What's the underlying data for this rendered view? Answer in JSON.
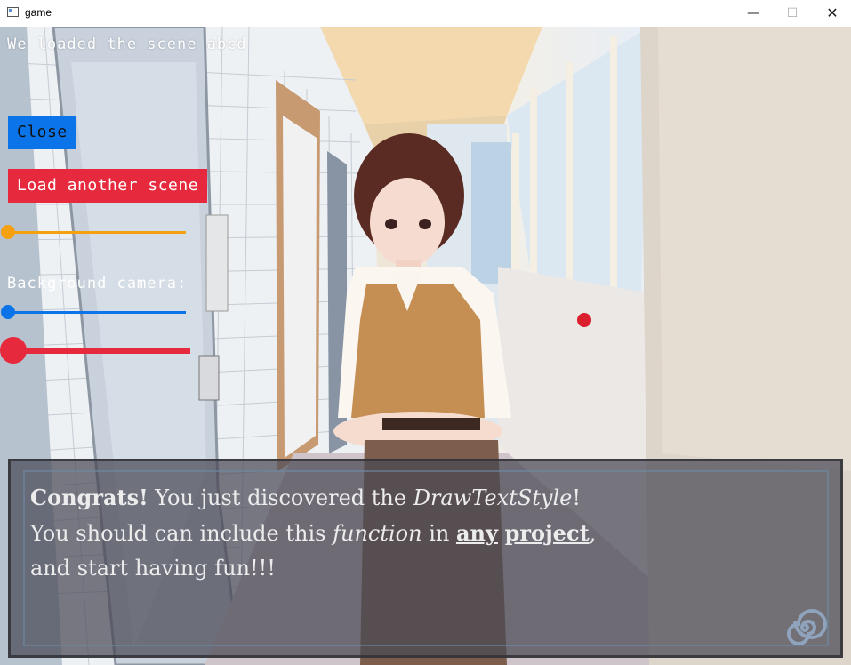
{
  "window": {
    "title": "game",
    "minimize_glyph": "—",
    "maximize_glyph": "☐",
    "close_glyph": "✕"
  },
  "overlay": {
    "status_text": "We loaded the scene abcd",
    "close_button_label": "Close",
    "load_button_label": "Load another scene",
    "background_camera_label": "Background camera:",
    "sliders": [
      {
        "name": "orange-slider",
        "value": 0.0,
        "color": "#f5a10f"
      },
      {
        "name": "background-camera-slider",
        "value": 0.0,
        "color": "#0a74e8"
      },
      {
        "name": "red-slider",
        "value": 0.0,
        "color": "#e6293c"
      }
    ]
  },
  "dialog": {
    "line1_bold": "Congrats!",
    "line1_rest": " You just discovered the ",
    "line1_italic": "DrawTextStyle",
    "line1_end": "!",
    "line2_start": "You should can include this ",
    "line2_italic": "function",
    "line2_mid": " in ",
    "line2_ul1": "any",
    "line2_space": " ",
    "line2_ul2": "project",
    "line2_end": ",",
    "line3": "and start having fun!!!",
    "advance_icon": "spiral-icon"
  },
  "colors": {
    "close_button": "#0a74e8",
    "load_button": "#e6293c",
    "dialog_bg": "#484854"
  }
}
